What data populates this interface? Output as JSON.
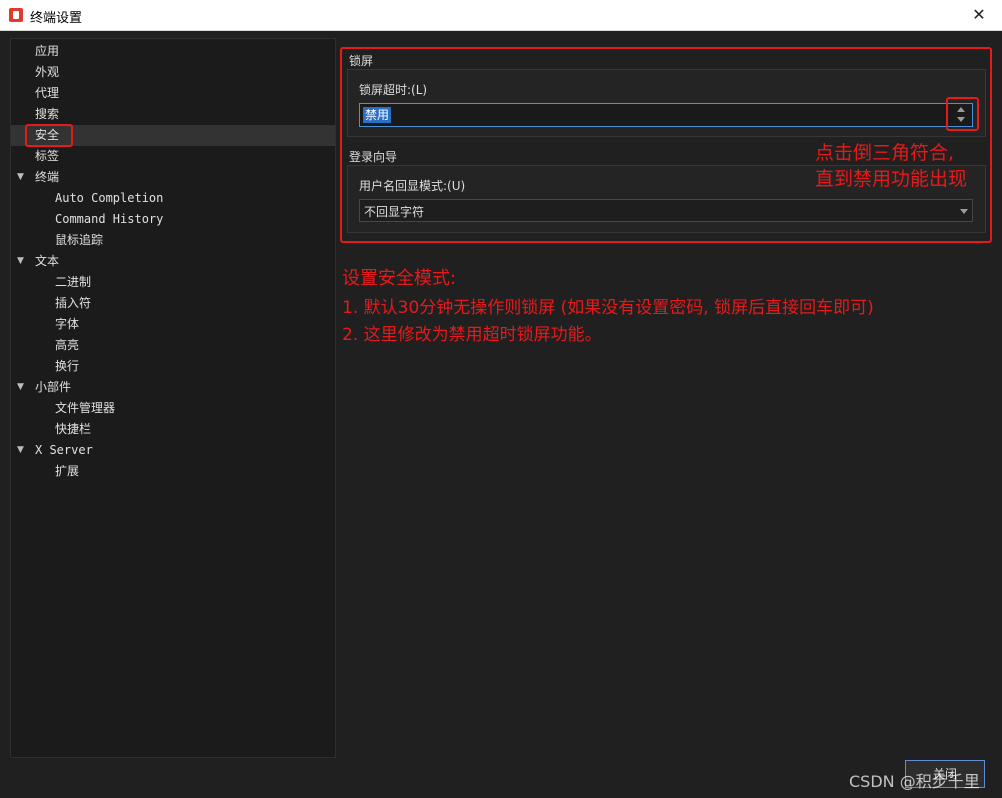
{
  "window": {
    "title": "终端设置",
    "close_glyph": "✕"
  },
  "sidebar": {
    "items": [
      {
        "label": "应用"
      },
      {
        "label": "外观"
      },
      {
        "label": "代理"
      },
      {
        "label": "搜索"
      },
      {
        "label": "安全"
      },
      {
        "label": "标签"
      },
      {
        "label": "终端"
      },
      {
        "label": "Auto Completion"
      },
      {
        "label": "Command History"
      },
      {
        "label": "鼠标追踪"
      },
      {
        "label": "文本"
      },
      {
        "label": "二进制"
      },
      {
        "label": "插入符"
      },
      {
        "label": "字体"
      },
      {
        "label": "高亮"
      },
      {
        "label": "换行"
      },
      {
        "label": "小部件"
      },
      {
        "label": "文件管理器"
      },
      {
        "label": "快捷栏"
      },
      {
        "label": "X Server"
      },
      {
        "label": "扩展"
      }
    ],
    "selected": "安全",
    "expand_glyph": "▼"
  },
  "lock_section": {
    "title": "锁屏",
    "timeout_label": "锁屏超时:(L)",
    "timeout_value": "禁用"
  },
  "login_section": {
    "title": "登录向导",
    "echo_label": "用户名回显模式:(U)",
    "echo_value": "不回显字符"
  },
  "annotations": {
    "spin_hint_line1": "点击倒三角符合,",
    "spin_hint_line2": "直到禁用功能出现",
    "note_title": "设置安全模式:",
    "note_line1": "1. 默认30分钟无操作则锁屏 (如果没有设置密码, 锁屏后直接回车即可)",
    "note_line2": "2. 这里修改为禁用超时锁屏功能。",
    "color": "#e8191a"
  },
  "footer": {
    "close_button": "关闭",
    "watermark": "CSDN @积步千里"
  },
  "colors": {
    "background": "#202020",
    "sidebar": "#1b1b1b",
    "accent": "#2a6fc4",
    "annotation": "#e8191a"
  }
}
